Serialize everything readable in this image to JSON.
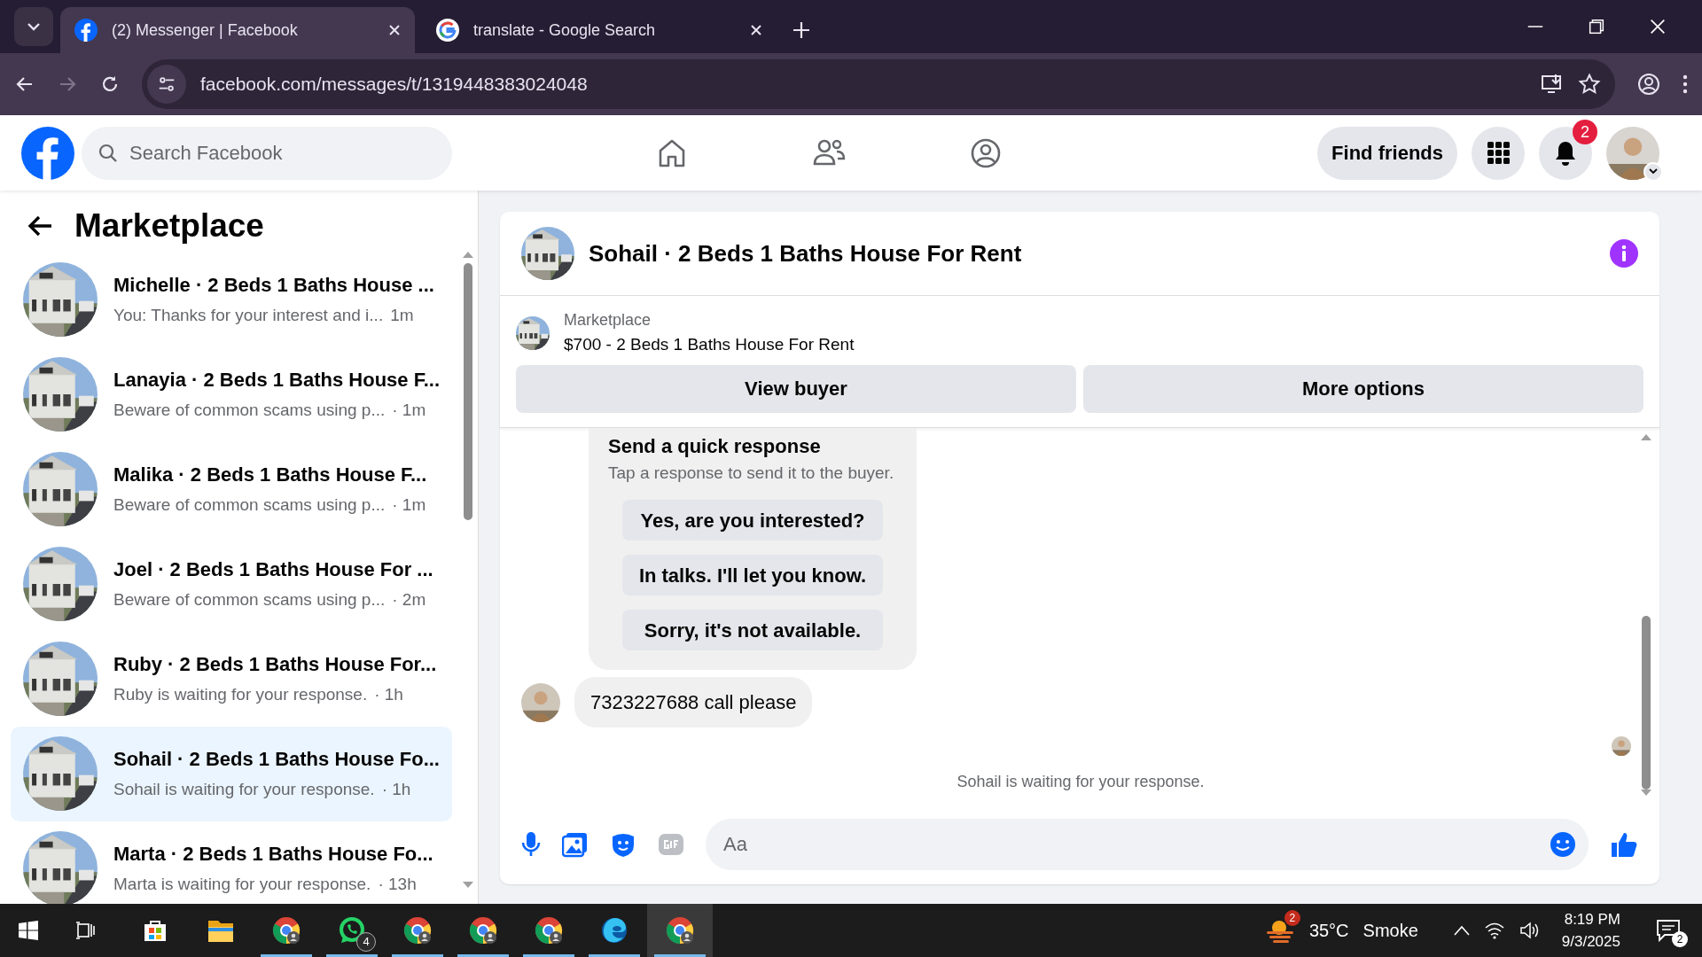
{
  "browser": {
    "tabs": [
      {
        "title": "(2) Messenger | Facebook",
        "selected": true
      },
      {
        "title": "translate - Google Search",
        "selected": false
      }
    ],
    "url": "facebook.com/messages/t/1319448383024048"
  },
  "header": {
    "search_placeholder": "Search Facebook",
    "find_friends": "Find friends",
    "notification_count": "2"
  },
  "sidebar": {
    "title": "Marketplace",
    "conversations": [
      {
        "title": "Michelle · 2 Beds 1 Baths House ...",
        "preview": "You: Thanks for your interest and i...",
        "time": "1m",
        "selected": false
      },
      {
        "title": "Lanayia · 2 Beds 1 Baths House F...",
        "preview": "Beware of common scams using p...",
        "time": "· 1m",
        "selected": false
      },
      {
        "title": "Malika · 2 Beds 1 Baths House F...",
        "preview": "Beware of common scams using p...",
        "time": "· 1m",
        "selected": false
      },
      {
        "title": "Joel · 2 Beds 1 Baths House For ...",
        "preview": "Beware of common scams using p...",
        "time": "· 2m",
        "selected": false
      },
      {
        "title": "Ruby · 2 Beds 1 Baths House For...",
        "preview": "Ruby is waiting for your response.",
        "time": "· 1h",
        "selected": false
      },
      {
        "title": "Sohail · 2 Beds 1 Baths House Fo...",
        "preview": "Sohail is waiting for your response.",
        "time": "· 1h",
        "selected": true
      },
      {
        "title": "Marta · 2 Beds 1 Baths House Fo...",
        "preview": "Marta is waiting for your response.",
        "time": "· 13h",
        "selected": false
      }
    ]
  },
  "chat": {
    "title": "Sohail · 2 Beds 1 Baths House For Rent",
    "listing_label": "Marketplace",
    "listing_title": "$700 - 2 Beds 1 Baths House For Rent",
    "buttons": [
      "View buyer",
      "More options"
    ],
    "quick_response": {
      "title": "Send a quick response",
      "subtitle": "Tap a response to send it to the buyer.",
      "options": [
        "Yes, are you interested?",
        "In talks. I'll let you know.",
        "Sorry, it's not available."
      ]
    },
    "message": "7323227688 call please",
    "status": "Sohail is waiting for your response.",
    "composer_placeholder": "Aa"
  },
  "taskbar": {
    "apps": [
      {
        "kind": "store",
        "running": false,
        "selected": false
      },
      {
        "kind": "folder",
        "running": false,
        "selected": false
      },
      {
        "kind": "chrome",
        "running": true,
        "selected": false
      },
      {
        "kind": "whatsapp",
        "running": true,
        "selected": false,
        "badge": "4"
      },
      {
        "kind": "chrome",
        "running": true,
        "selected": false
      },
      {
        "kind": "chrome",
        "running": true,
        "selected": false
      },
      {
        "kind": "chrome",
        "running": true,
        "selected": false
      },
      {
        "kind": "edge",
        "running": true,
        "selected": false
      },
      {
        "kind": "chrome",
        "running": true,
        "selected": true
      }
    ],
    "weather_badge": "2",
    "temperature": "35°C",
    "weather": "Smoke",
    "time": "8:19 PM",
    "date": "9/3/2025",
    "notifications": "2"
  }
}
